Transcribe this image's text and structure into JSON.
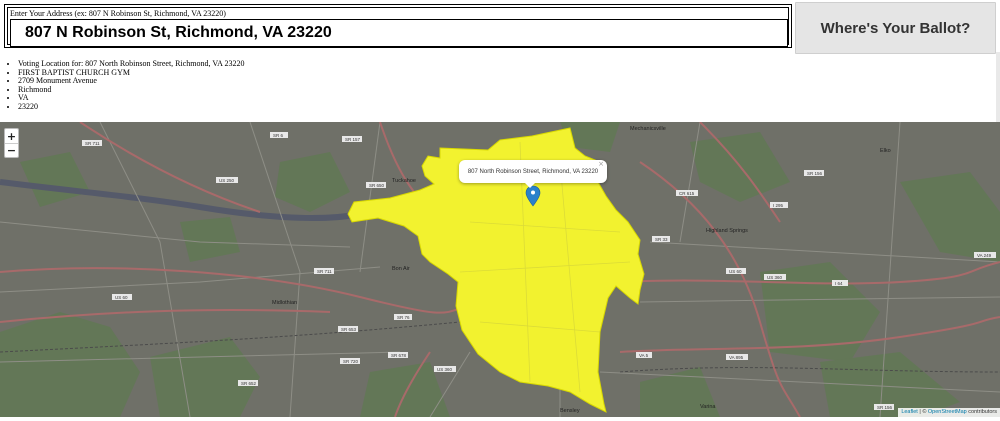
{
  "form": {
    "label": "Enter Your Address (ex: 807 N Robinson St, Richmond, VA 23220)",
    "address_value": "807 N Robinson St, Richmond, VA 23220",
    "button_label": "Where's Your Ballot?"
  },
  "results": {
    "items": [
      "Voting Location for: 807 North Robinson Street, Richmond, VA 23220",
      "FIRST BAPTIST CHURCH GYM",
      "2709 Monument Avenue",
      "Richmond",
      "VA",
      "23220"
    ]
  },
  "map": {
    "zoom_in": "+",
    "zoom_out": "−",
    "popup_text": "807 North Robinson Street, Richmond, VA 23220",
    "popup_close": "×",
    "attribution_leaflet": "Leaflet",
    "attribution_sep": " | © ",
    "attribution_osm": "OpenStreetMap",
    "attribution_tail": " contributors",
    "highlight_color": "#f2f22f",
    "marker_color": "#2a81cb",
    "places": {
      "tuckahoe": "Tuckahoe",
      "highland_springs": "Highland Springs",
      "bon_air": "Bon Air",
      "midlothian": "Midlothian",
      "bensley": "Bensley",
      "varina": "Varina",
      "mechanicsville": "Mechanicsville",
      "elko": "Elko"
    },
    "roads": {
      "sr711": "SR 711",
      "sr157": "SR 157",
      "sr6": "SR 6",
      "us250": "US 250",
      "sr650": "SR 650",
      "us60": "US 60",
      "sr711b": "SR 711",
      "sr653": "SR 653",
      "sr76": "SR 76",
      "sr720": "SR 720",
      "sr678": "SR 678",
      "sr652": "SR 652",
      "us360": "US 360",
      "va5": "VA 5",
      "va895": "VA 895",
      "cr615": "CR 615",
      "i295": "I 295",
      "i64": "I 64",
      "sr33": "SR 33",
      "sr156": "SR 156",
      "va249": "VA 249",
      "us60b": "US 60",
      "us360b": "US 360",
      "sr156b": "SR 156"
    }
  }
}
